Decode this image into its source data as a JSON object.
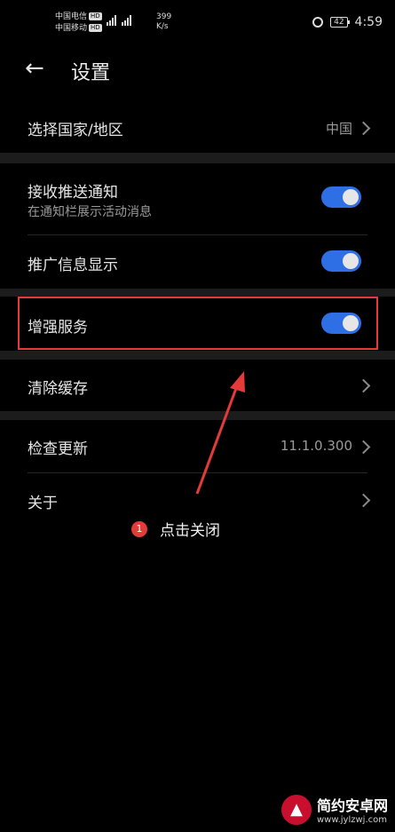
{
  "status_bar": {
    "carrier1": "中国电信",
    "carrier2": "中国移动",
    "hd": "HD",
    "speed_value": "399",
    "speed_unit": "K/s",
    "battery": "42",
    "time": "4:59"
  },
  "header": {
    "title": "设置"
  },
  "rows": {
    "region": {
      "label": "选择国家/地区",
      "value": "中国"
    },
    "push": {
      "label": "接收推送通知",
      "sub": "在通知栏展示活动消息",
      "toggle_on": true
    },
    "promo": {
      "label": "推广信息显示",
      "toggle_on": true
    },
    "enhance": {
      "label": "增强服务",
      "toggle_on": true
    },
    "cache": {
      "label": "清除缓存"
    },
    "update": {
      "label": "检查更新",
      "value": "11.1.0.300"
    },
    "about": {
      "label": "关于"
    }
  },
  "annotation": {
    "number": "1",
    "text": "点击关闭",
    "color": "#e43a3a"
  },
  "watermark": {
    "title": "简约安卓网",
    "url": "www.jylzwj.com"
  },
  "colors": {
    "toggle_on": "#2f6fe5",
    "highlight": "#e43a3a"
  }
}
